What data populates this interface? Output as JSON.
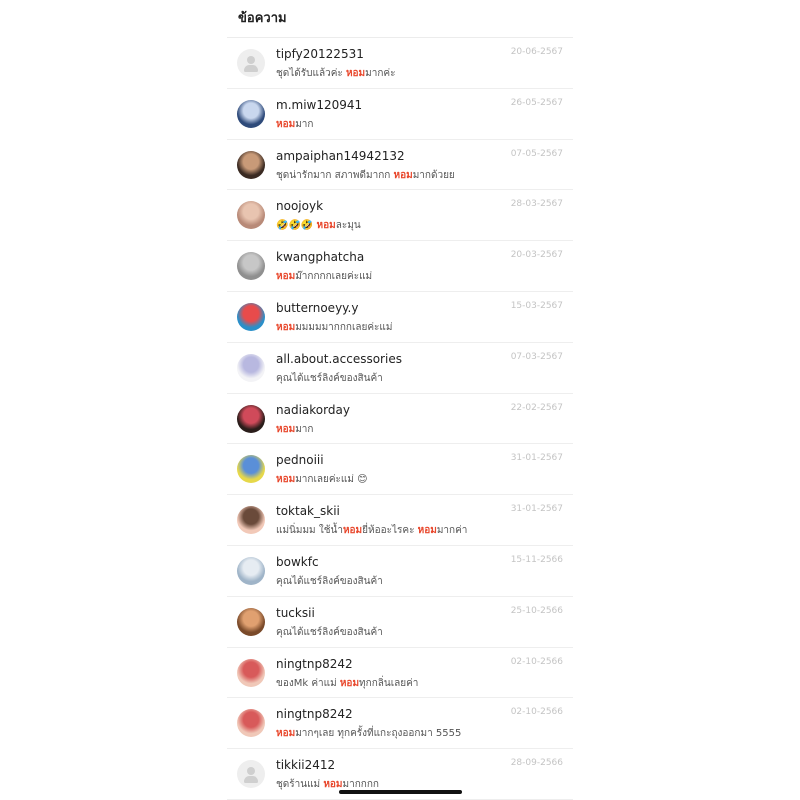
{
  "header": {
    "title": "ข้อความ"
  },
  "conversations": [
    {
      "name": "tipfy20122531",
      "date": "20-06-2567",
      "avatar": "placeholder",
      "colors": [
        "#eeeeee",
        "#cfcfcf"
      ],
      "message": [
        {
          "t": "ชุดได้รับแล้วค่ะ "
        },
        {
          "t": "หอม",
          "hl": true
        },
        {
          "t": "มากค่ะ"
        }
      ]
    },
    {
      "name": "m.miw120941",
      "date": "26-05-2567",
      "avatar": "photo",
      "colors": [
        "#2e4a7a",
        "#c9d7ee"
      ],
      "message": [
        {
          "t": "หอม",
          "hl": true
        },
        {
          "t": "มาก"
        }
      ]
    },
    {
      "name": "ampaiphan14942132",
      "date": "07-05-2567",
      "avatar": "photo",
      "colors": [
        "#3a2a22",
        "#c89a78"
      ],
      "message": [
        {
          "t": "ชุดน่ารักมาก สภาพดีมากก "
        },
        {
          "t": "หอม",
          "hl": true
        },
        {
          "t": "มากด้วยย"
        }
      ]
    },
    {
      "name": "noojoyk",
      "date": "28-03-2567",
      "avatar": "photo",
      "colors": [
        "#b88a78",
        "#e8c4b0"
      ],
      "message": [
        {
          "t": "🤣🤣🤣 "
        },
        {
          "t": "หอม",
          "hl": true
        },
        {
          "t": "ละมุน"
        }
      ]
    },
    {
      "name": "kwangphatcha",
      "date": "20-03-2567",
      "avatar": "photo",
      "colors": [
        "#8f8f8f",
        "#c7c7c7"
      ],
      "message": [
        {
          "t": "หอม",
          "hl": true
        },
        {
          "t": "ม๊ากกกกเลยค่ะแม่"
        }
      ]
    },
    {
      "name": "butternoeyy.y",
      "date": "15-03-2567",
      "avatar": "photo",
      "colors": [
        "#2a8fc9",
        "#e84b4b"
      ],
      "message": [
        {
          "t": "หอม",
          "hl": true
        },
        {
          "t": "มมมมมากกกเลยค่ะแม่"
        }
      ]
    },
    {
      "name": "all.about.accessories",
      "date": "07-03-2567",
      "avatar": "photo",
      "colors": [
        "#f3f3f6",
        "#b8b8e0"
      ],
      "message": [
        {
          "t": "คุณได้แชร์ลิงค์ของสินค้า"
        }
      ]
    },
    {
      "name": "nadiakorday",
      "date": "22-02-2567",
      "avatar": "photo",
      "colors": [
        "#2a1d1a",
        "#d04a5a"
      ],
      "message": [
        {
          "t": "หอม",
          "hl": true
        },
        {
          "t": "มาก"
        }
      ]
    },
    {
      "name": "pednoiii",
      "date": "31-01-2567",
      "avatar": "photo",
      "colors": [
        "#e6d84a",
        "#5a8fd8"
      ],
      "message": [
        {
          "t": "หอม",
          "hl": true
        },
        {
          "t": "มากเลยค่ะแม่ 😊"
        }
      ]
    },
    {
      "name": "toktak_skii",
      "date": "31-01-2567",
      "avatar": "photo",
      "colors": [
        "#f2c9b8",
        "#6a4a3a"
      ],
      "message": [
        {
          "t": "แม่นิ่มมม ใช้น้ำ"
        },
        {
          "t": "หอม",
          "hl": true
        },
        {
          "t": "ยี่ห้ออะไรคะ "
        },
        {
          "t": "หอม",
          "hl": true
        },
        {
          "t": "มากค่า"
        }
      ]
    },
    {
      "name": "bowkfc",
      "date": "15-11-2566",
      "avatar": "photo",
      "colors": [
        "#9fb4c8",
        "#e6ecf2"
      ],
      "message": [
        {
          "t": "คุณได้แชร์ลิงค์ของสินค้า"
        }
      ]
    },
    {
      "name": "tucksii",
      "date": "25-10-2566",
      "avatar": "photo",
      "colors": [
        "#7a4a2a",
        "#e0a070"
      ],
      "message": [
        {
          "t": "คุณได้แชร์ลิงค์ของสินค้า"
        }
      ]
    },
    {
      "name": "ningtnp8242",
      "date": "02-10-2566",
      "avatar": "photo",
      "colors": [
        "#f0c8b8",
        "#d85a5a"
      ],
      "message": [
        {
          "t": "ของMk ค่าแม่ "
        },
        {
          "t": "หอม",
          "hl": true
        },
        {
          "t": "ทุกกลิ่นเลยค่า"
        }
      ]
    },
    {
      "name": "ningtnp8242",
      "date": "02-10-2566",
      "avatar": "photo",
      "colors": [
        "#f0c8b8",
        "#d85a5a"
      ],
      "message": [
        {
          "t": "หอม",
          "hl": true
        },
        {
          "t": "มากๆเลย ทุกครั้งที่แกะถุงออกมา 5555"
        }
      ]
    },
    {
      "name": "tikkii2412",
      "date": "28-09-2566",
      "avatar": "placeholder",
      "colors": [
        "#eeeeee",
        "#cfcfcf"
      ],
      "message": [
        {
          "t": "ชุดร้านแม่ "
        },
        {
          "t": "หอม",
          "hl": true
        },
        {
          "t": "มากกกก"
        }
      ]
    }
  ]
}
